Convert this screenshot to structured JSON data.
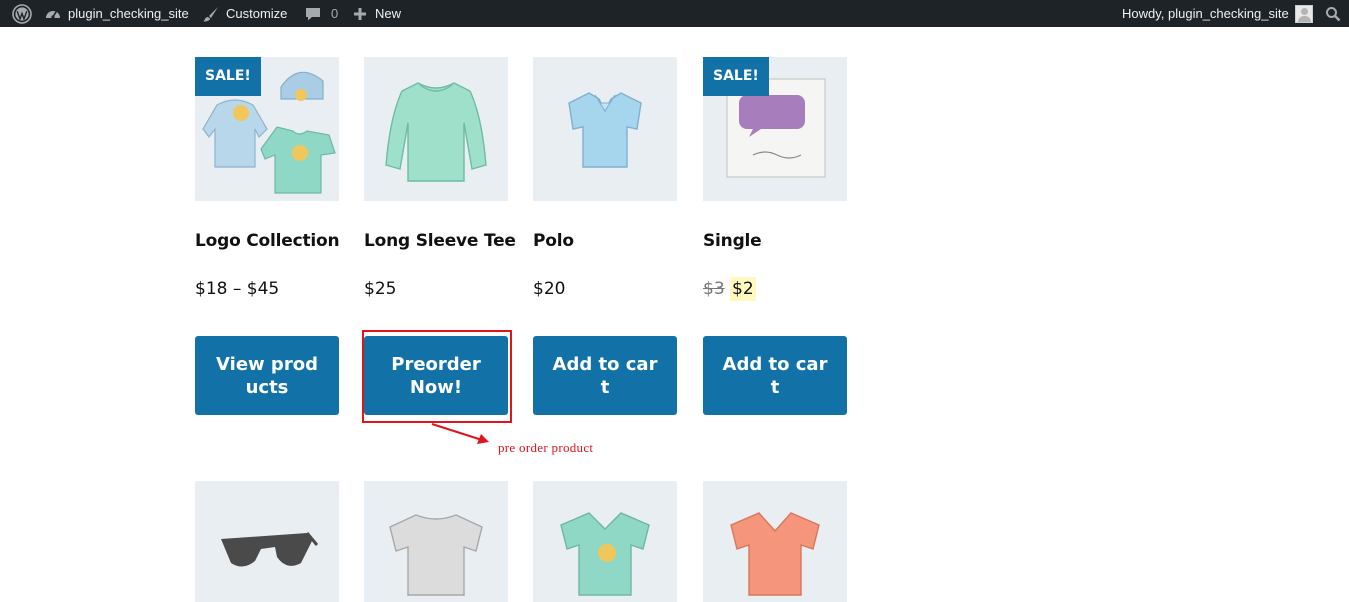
{
  "admin_bar": {
    "site_name": "plugin_checking_site",
    "customize_label": "Customize",
    "comments_count": "0",
    "new_label": "New",
    "greeting": "Howdy, plugin_checking_site",
    "icons": [
      "wordpress-icon",
      "dashboard-icon",
      "brush-icon",
      "comment-icon",
      "plus-icon",
      "avatar",
      "search-icon"
    ]
  },
  "products_row1": [
    {
      "name": "Logo Collection",
      "price": "$18 – $45",
      "button": "View products",
      "sale_badge": "SALE!"
    },
    {
      "name": "Long Sleeve Tee",
      "price": "$25",
      "button": "Preorder Now!"
    },
    {
      "name": "Polo",
      "price": "$20",
      "button": "Add to cart"
    },
    {
      "name": "Single",
      "price_old": "$3",
      "price_new": "$2",
      "button": "Add to cart",
      "sale_badge": "SALE!"
    }
  ],
  "products_row2": [
    {
      "image": "sunglasses"
    },
    {
      "image": "white t-shirt"
    },
    {
      "image": "green v-neck t-shirt with logo"
    },
    {
      "image": "orange v-neck t-shirt"
    }
  ],
  "annotation": {
    "label": "pre order product",
    "color": "#e0141c"
  },
  "colors": {
    "admin_bar_bg": "#1d2327",
    "button_bg": "#1272a8",
    "thumb_bg": "#e9eef2",
    "sale_price_highlight": "#fff9c0"
  }
}
